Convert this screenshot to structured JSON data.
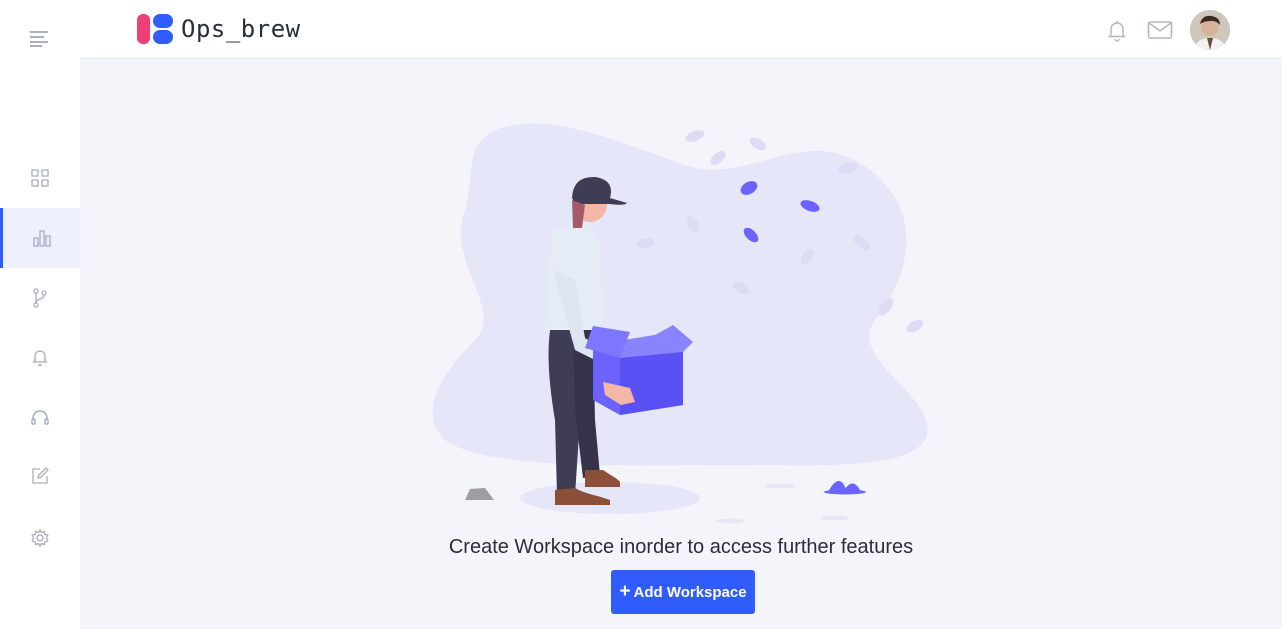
{
  "app": {
    "name": "Ops_brew"
  },
  "sidebar": {
    "items": [
      {
        "icon": "grid-icon"
      },
      {
        "icon": "bar-chart-icon",
        "active": true
      },
      {
        "icon": "git-branch-icon"
      },
      {
        "icon": "bell-icon"
      },
      {
        "icon": "headset-icon"
      },
      {
        "icon": "edit-icon"
      },
      {
        "icon": "gear-icon"
      }
    ]
  },
  "header": {
    "icons": [
      "bell-icon",
      "mail-icon"
    ]
  },
  "main": {
    "empty_message": "Create Workspace inorder to access further features",
    "add_button_label": "Add Workspace"
  },
  "colors": {
    "accent": "#2f5cfa",
    "illustration": "#6c63ff",
    "logo_pink": "#f03e78"
  }
}
